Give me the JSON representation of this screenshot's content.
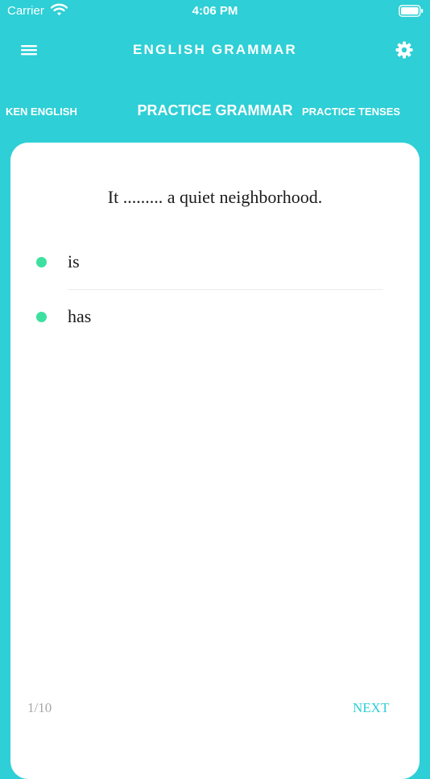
{
  "status_bar": {
    "carrier": "Carrier",
    "time": "4:06 PM",
    "icons": [
      "wifi-icon",
      "battery-icon"
    ]
  },
  "header": {
    "title": "ENGLISH GRAMMAR",
    "left_icon": "menu-icon",
    "right_icon": "gear-icon"
  },
  "tabs": [
    {
      "label": "KEN ENGLISH"
    },
    {
      "label": "PRACTICE GRAMMAR"
    },
    {
      "label": "PRACTICE TENSES"
    }
  ],
  "quiz": {
    "question": "It ......... a quiet neighborhood.",
    "options": [
      {
        "label": "is"
      },
      {
        "label": "has"
      }
    ],
    "progress": "1/10",
    "next_label": "NEXT"
  },
  "colors": {
    "background": "#2ecfd6",
    "card": "#ffffff",
    "option_dot": "#3ee0a0",
    "next_text": "#2ecfd6"
  }
}
